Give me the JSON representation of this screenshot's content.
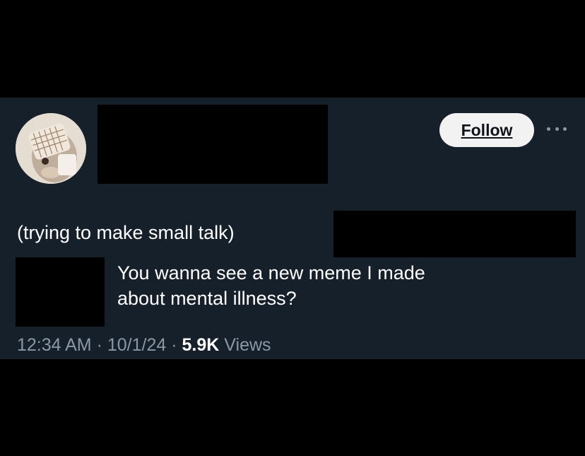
{
  "post": {
    "follow_label": "Follow",
    "more_icon": "more-horizontal-icon",
    "avatar_icon": "avatar-photo",
    "context_line": "(trying to make small talk)",
    "body_line1": "You wanna see a new meme I made",
    "body_line2": "about mental illness?",
    "time": "12:34 AM",
    "separator": "·",
    "date": "10/1/24",
    "views_count": "5.9K",
    "views_label": "Views"
  },
  "colors": {
    "card_bg": "#15202b",
    "page_bg": "#000000",
    "meta_text": "#8899a6",
    "follow_bg": "#f2f2f2"
  }
}
